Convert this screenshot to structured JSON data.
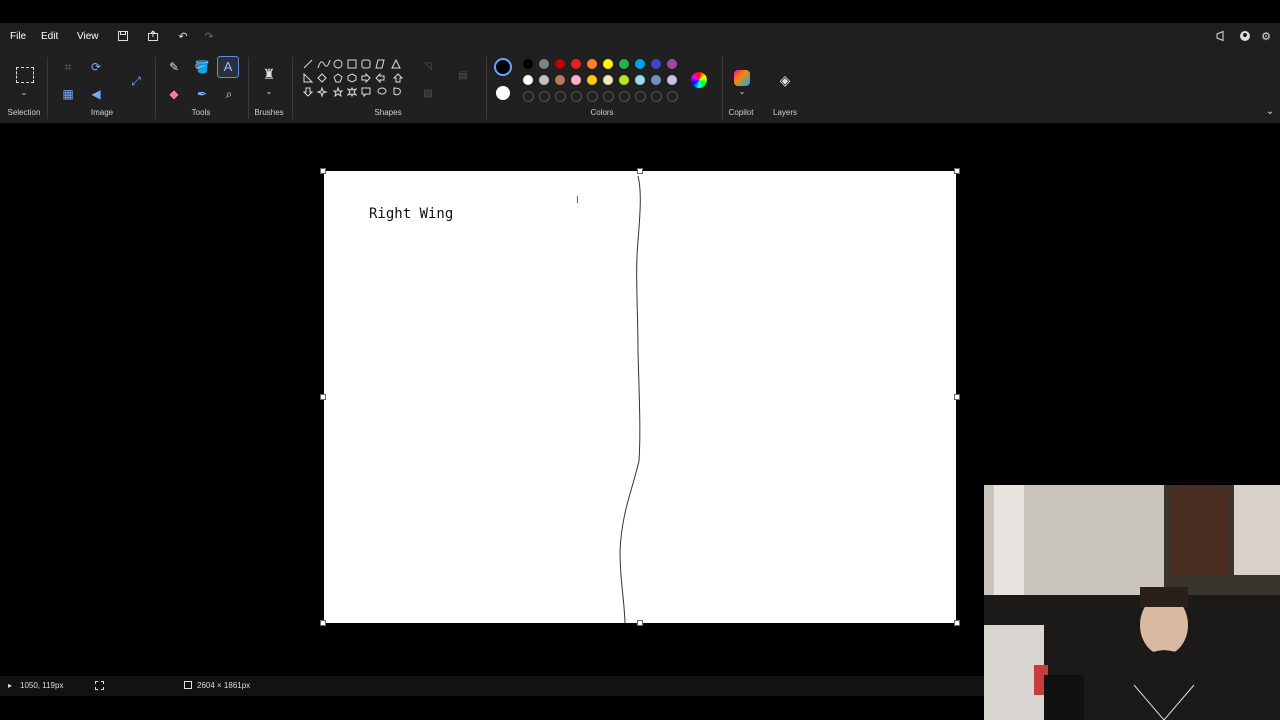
{
  "menu": {
    "file": "File",
    "edit": "Edit",
    "view": "View"
  },
  "ribbon": {
    "groups": {
      "selection": "Selection",
      "image": "Image",
      "tools": "Tools",
      "brushes": "Brushes",
      "shapes": "Shapes",
      "colors": "Colors",
      "copilot": "Copilot",
      "layers": "Layers"
    }
  },
  "colors": {
    "row1": [
      "#000000",
      "#7f7f7f",
      "#c00000",
      "#ed1c24",
      "#ff7f27",
      "#fff200",
      "#22b14c",
      "#00a2e8",
      "#3f48cc",
      "#a349a4"
    ],
    "row2": [
      "#ffffff",
      "#c3c3c3",
      "#b97a57",
      "#ffaec9",
      "#ffc90e",
      "#efe4b0",
      "#b5e61d",
      "#99d9ea",
      "#7092be",
      "#c8bfe7"
    ],
    "primary": "#000000",
    "secondary": "#ffffff"
  },
  "canvas": {
    "text": "Right Wing"
  },
  "status": {
    "cursor_pos": "1050, 119px",
    "canvas_size": "2604 × 1861px"
  }
}
